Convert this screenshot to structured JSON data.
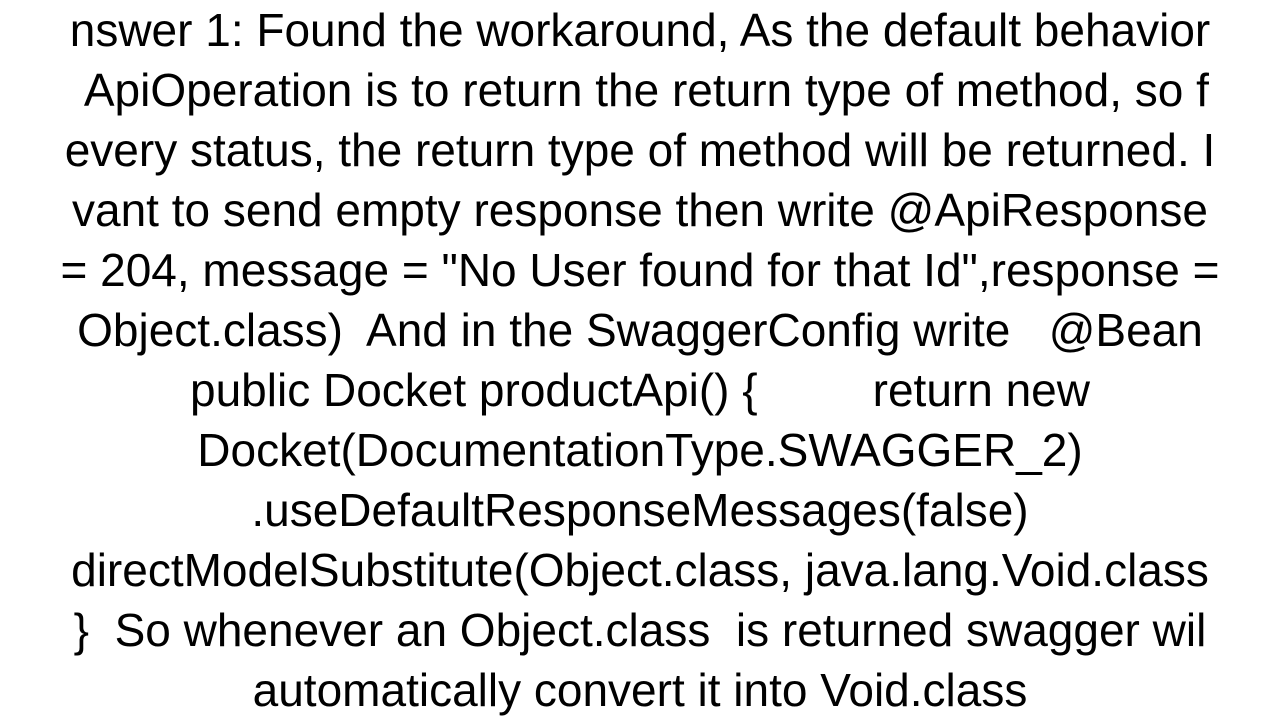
{
  "answer": {
    "lines": [
      "nswer 1: Found the workaround, As the default behavior",
      " ApiOperation is to return the return type of method, so f",
      "every status, the return type of method will be returned. I",
      "vant to send empty response then write @ApiResponse",
      "= 204, message = \"No User found for that Id\",response =",
      "Object.class)  And in the SwaggerConfig write   @Bean",
      "public Docket productApi() {         return new",
      "Docket(DocumentationType.SWAGGER_2)",
      ".useDefaultResponseMessages(false)",
      "directModelSubstitute(Object.class, java.lang.Void.class",
      "}  So whenever an Object.class  is returned swagger wil",
      "automatically convert it into Void.class"
    ]
  }
}
